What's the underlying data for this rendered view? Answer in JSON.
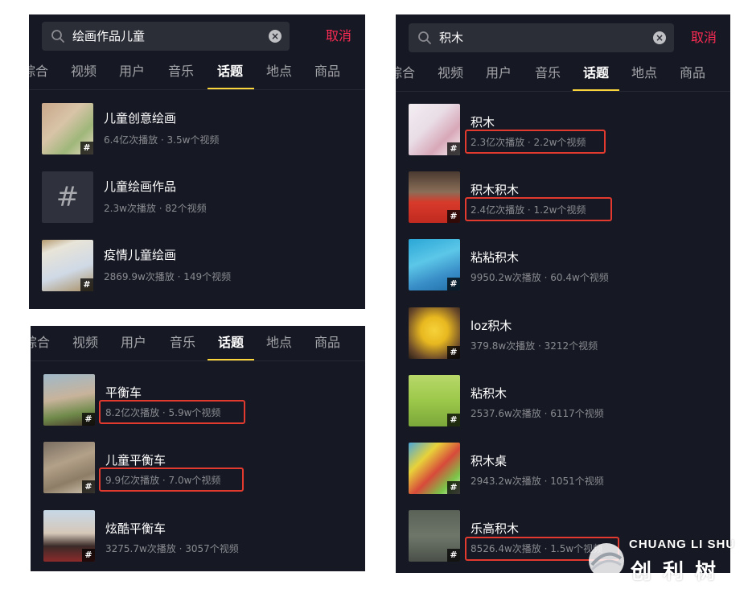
{
  "colors": {
    "panel_bg": "#161823",
    "accent_cancel": "#fe2c55",
    "tab_underline": "#fad63c",
    "highlight_box": "#e23a2e"
  },
  "panel_a": {
    "search": {
      "query": "绘画作品儿童",
      "cancel_label": "取消"
    },
    "tabs": [
      "综合",
      "视频",
      "用户",
      "音乐",
      "话题",
      "地点",
      "商品"
    ],
    "active_tab": "话题",
    "items": [
      {
        "title": "儿童创意绘画",
        "stats": "6.4亿次播放 · 3.5w个视频",
        "badge": "#"
      },
      {
        "title": "儿童绘画作品",
        "stats": "2.3w次播放 · 82个视频",
        "badge": "#"
      },
      {
        "title": "疫情儿童绘画",
        "stats": "2869.9w次播放 · 149个视频",
        "badge": "#"
      }
    ]
  },
  "panel_b": {
    "tabs": [
      "综合",
      "视频",
      "用户",
      "音乐",
      "话题",
      "地点",
      "商品"
    ],
    "active_tab": "话题",
    "items": [
      {
        "title": "平衡车",
        "stats": "8.2亿次播放 · 5.9w个视频",
        "badge": "#"
      },
      {
        "title": "儿童平衡车",
        "stats": "9.9亿次播放 · 7.0w个视频",
        "badge": "#"
      },
      {
        "title": "炫酷平衡车",
        "stats": "3275.7w次播放 · 3057个视频",
        "badge": "#"
      }
    ]
  },
  "panel_c": {
    "search": {
      "query": "积木",
      "cancel_label": "取消"
    },
    "tabs": [
      "综合",
      "视频",
      "用户",
      "音乐",
      "话题",
      "地点",
      "商品"
    ],
    "active_tab": "话题",
    "items": [
      {
        "title": "积木",
        "stats": "2.3亿次播放 · 2.2w个视频",
        "badge": "#"
      },
      {
        "title": "积木积木",
        "stats": "2.4亿次播放 · 1.2w个视频",
        "badge": "#"
      },
      {
        "title": "粘粘积木",
        "stats": "9950.2w次播放 · 60.4w个视频",
        "badge": "#"
      },
      {
        "title": "loz积木",
        "stats": "379.8w次播放 · 3212个视频",
        "badge": "#"
      },
      {
        "title": "粘积木",
        "stats": "2537.6w次播放 · 6117个视频",
        "badge": "#"
      },
      {
        "title": "积木桌",
        "stats": "2943.2w次播放 · 1051个视频",
        "badge": "#"
      },
      {
        "title": "乐高积木",
        "stats": "8526.4w次播放 · 1.5w个视频",
        "badge": "#"
      }
    ]
  },
  "watermark": {
    "text_en": "CHUANG LI SHU",
    "text_cn": "创利树"
  }
}
